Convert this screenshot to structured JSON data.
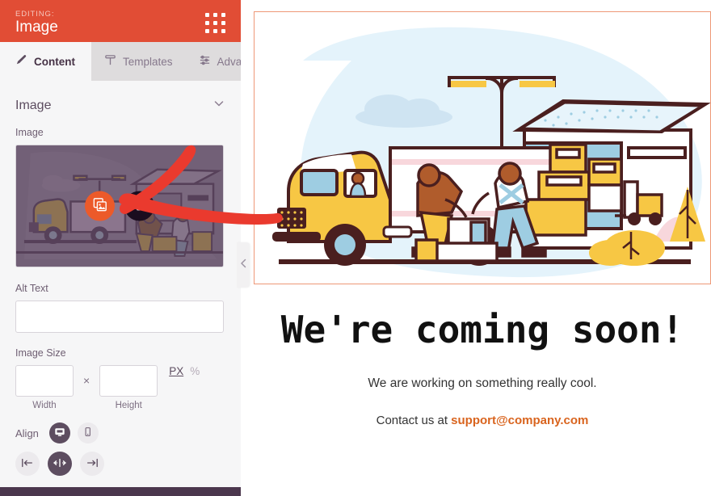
{
  "panel": {
    "header": {
      "editing_label": "EDITING:",
      "title": "Image",
      "drag_handle_icon": "grid-dots-icon",
      "bg_color": "#e14d35"
    },
    "tabs": [
      {
        "label": "Content",
        "icon": "pencil-icon",
        "active": true
      },
      {
        "label": "Templates",
        "icon": "template-icon",
        "active": false
      },
      {
        "label": "Advanced",
        "icon": "sliders-icon",
        "active": false
      }
    ],
    "section": {
      "title": "Image",
      "collapse_icon": "chevron-down-icon"
    },
    "fields": {
      "image_label": "Image",
      "thumbnail": {
        "replace_icon": "stacked-images-icon",
        "delete_icon": "trash-icon",
        "replace_color": "#ec5a2a",
        "delete_color": "#1b0d1f"
      },
      "alt_text_label": "Alt Text",
      "alt_text_value": "",
      "alt_text_placeholder": "",
      "image_size_label": "Image Size",
      "width_value": "",
      "width_caption": "Width",
      "height_value": "",
      "height_caption": "Height",
      "size_separator": "×",
      "units": [
        {
          "label": "PX",
          "active": true
        },
        {
          "label": "%",
          "active": false
        }
      ],
      "align_label": "Align",
      "device_toggles": [
        {
          "name": "desktop",
          "icon": "desktop-icon",
          "active": true
        },
        {
          "name": "mobile",
          "icon": "mobile-icon",
          "active": false
        }
      ],
      "align_options": [
        {
          "name": "left",
          "icon": "align-left-icon",
          "active": false
        },
        {
          "name": "center",
          "icon": "align-center-icon",
          "active": true
        },
        {
          "name": "right",
          "icon": "align-right-icon",
          "active": false
        }
      ]
    },
    "collapse_icon": "chevron-left-icon",
    "footer_color": "#4b374d"
  },
  "preview": {
    "frame_border_color": "#ee9877",
    "illustration": {
      "name": "warehouse-delivery-illustration",
      "bg_blob_color": "#e3f2fa",
      "truck_color": "#f7c744",
      "outline_color": "#4a1f1f",
      "accent_blue": "#9ecde2",
      "accent_pink": "#f5c9cf"
    },
    "heading": "We're coming soon!",
    "subtitle": "We are working on something really cool.",
    "contact_prefix": "Contact us at ",
    "contact_email": "support@company.com",
    "contact_email_color": "#d9641e"
  },
  "annotation": {
    "arrow_color": "#ea3a2e",
    "points_to": "replace-image-button"
  }
}
